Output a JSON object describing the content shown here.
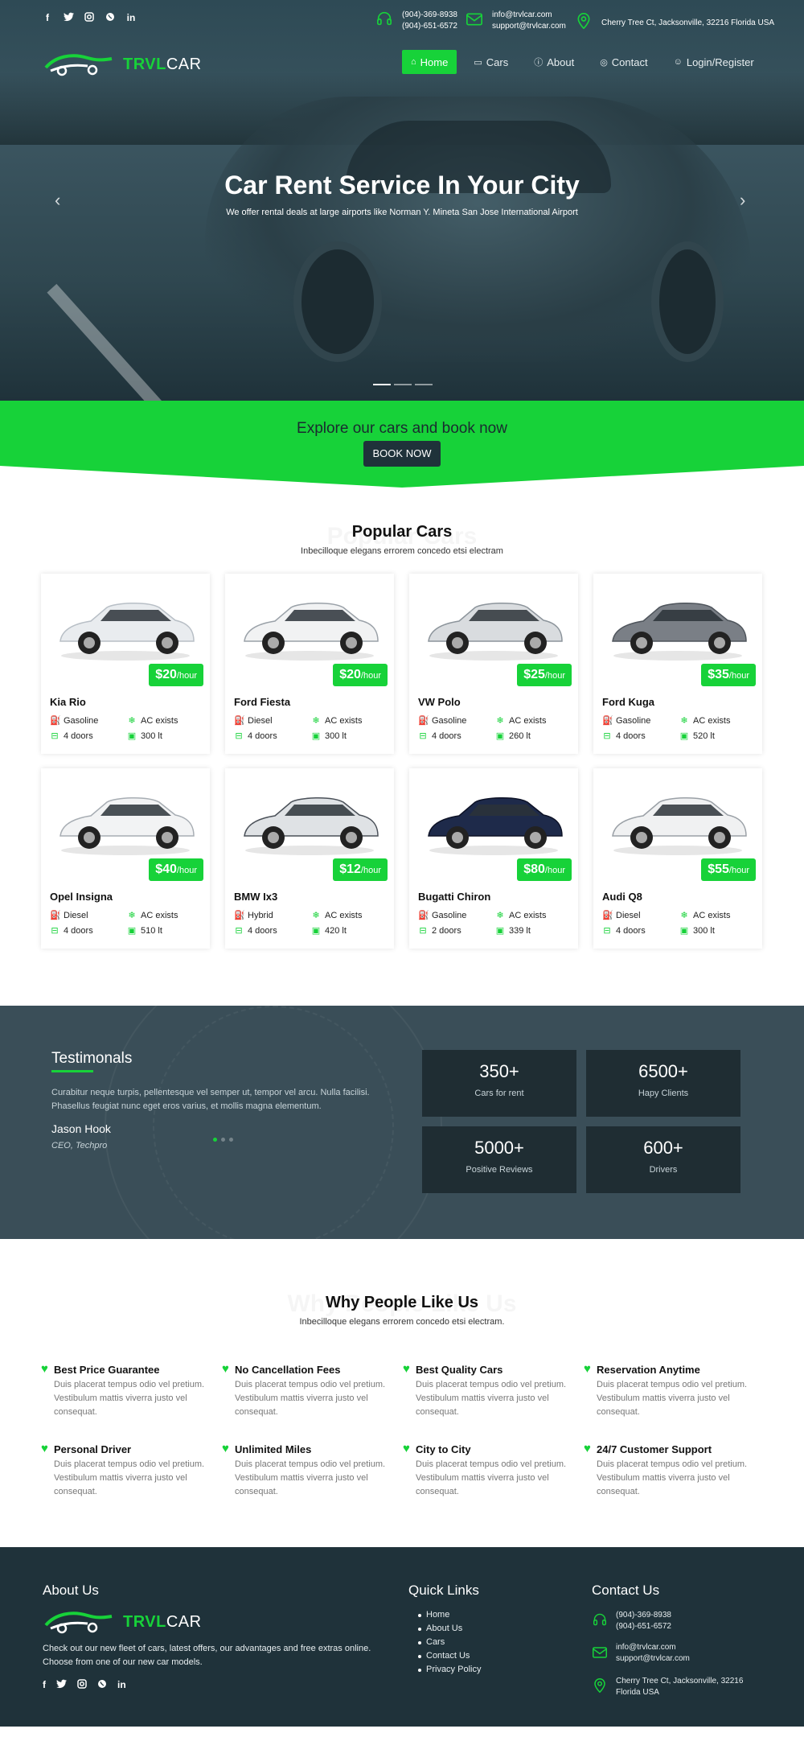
{
  "topbar": {
    "social": [
      "f",
      "t",
      "ig",
      "wa",
      "in"
    ],
    "phone": [
      "(904)-369-8938",
      "(904)-651-6572"
    ],
    "email": [
      "info@trvlcar.com",
      "support@trvlcar.com"
    ],
    "address": "Cherry Tree Ct, Jacksonville, 32216 Florida USA"
  },
  "logo": {
    "part1": "TRVL",
    "part2": "CAR"
  },
  "nav": [
    {
      "label": "Home",
      "icon": "home-icon"
    },
    {
      "label": "Cars",
      "icon": "car-icon"
    },
    {
      "label": "About",
      "icon": "info-icon"
    },
    {
      "label": "Contact",
      "icon": "location-icon"
    },
    {
      "label": "Login/Register",
      "icon": "user-icon"
    }
  ],
  "hero": {
    "title": "Car Rent Service In Your City",
    "subtitle": "We offer rental deals at large airports like Norman Y. Mineta San Jose International Airport"
  },
  "cta": {
    "title": "Explore our cars and book now",
    "button": "BOOK NOW"
  },
  "popular": {
    "ghost": "Popular Cars",
    "title": "Popular Cars",
    "subtitle": "Inbecilloque elegans errorem concedo etsi electram",
    "cars": [
      {
        "name": "Kia Rio",
        "price": "$20",
        "unit": "/hour",
        "fuel": "Gasoline",
        "ac": "AC exists",
        "doors": "4 doors",
        "trunk": "300 lt",
        "color": "#e9ecef",
        "accent": "#b8bfc6"
      },
      {
        "name": "Ford Fiesta",
        "price": "$20",
        "unit": "/hour",
        "fuel": "Diesel",
        "ac": "AC exists",
        "doors": "4 doors",
        "trunk": "300 lt",
        "color": "#f1f2f3",
        "accent": "#9aa1a8"
      },
      {
        "name": "VW Polo",
        "price": "$25",
        "unit": "/hour",
        "fuel": "Gasoline",
        "ac": "AC exists",
        "doors": "4 doors",
        "trunk": "260 lt",
        "color": "#d9dcdf",
        "accent": "#8c949b"
      },
      {
        "name": "Ford Kuga",
        "price": "$35",
        "unit": "/hour",
        "fuel": "Gasoline",
        "ac": "AC exists",
        "doors": "4 doors",
        "trunk": "520 lt",
        "color": "#7a7f86",
        "accent": "#4f555c"
      },
      {
        "name": "Opel Insigna",
        "price": "$40",
        "unit": "/hour",
        "fuel": "Diesel",
        "ac": "AC exists",
        "doors": "4 doors",
        "trunk": "510 lt",
        "color": "#f2f3f4",
        "accent": "#a7adb3"
      },
      {
        "name": "BMW Ix3",
        "price": "$12",
        "unit": "/hour",
        "fuel": "Hybrid",
        "ac": "AC exists",
        "doors": "4 doors",
        "trunk": "420 lt",
        "color": "#dfe2e5",
        "accent": "#4a5058"
      },
      {
        "name": "Bugatti Chiron",
        "price": "$80",
        "unit": "/hour",
        "fuel": "Gasoline",
        "ac": "AC exists",
        "doors": "2 doors",
        "trunk": "339 lt",
        "color": "#1e2a4a",
        "accent": "#0d1226"
      },
      {
        "name": "Audi Q8",
        "price": "$55",
        "unit": "/hour",
        "fuel": "Diesel",
        "ac": "AC exists",
        "doors": "4 doors",
        "trunk": "300 lt",
        "color": "#f0f1f2",
        "accent": "#9aa0a6"
      }
    ]
  },
  "testimonials": {
    "title": "Testimonals",
    "quote": "Curabitur neque turpis, pellentesque vel semper ut, tempor vel arcu. Nulla facilisi. Phasellus feugiat nunc eget eros varius, et mollis magna elementum.",
    "author": "Jason Hook",
    "role": "CEO, Techpro",
    "stats": [
      {
        "number": "350+",
        "label": "Cars for rent"
      },
      {
        "number": "6500+",
        "label": "Hapy Clients"
      },
      {
        "number": "5000+",
        "label": "Positive Reviews"
      },
      {
        "number": "600+",
        "label": "Drivers"
      }
    ]
  },
  "why": {
    "ghost": "Why People Like Us",
    "title": "Why People Like Us",
    "subtitle": "Inbecilloque elegans errorem concedo etsi electram.",
    "features": [
      {
        "title": "Best Price Guarantee",
        "desc": "Duis placerat tempus odio vel pretium. Vestibulum mattis viverra justo vel consequat."
      },
      {
        "title": "No Cancellation Fees",
        "desc": "Duis placerat tempus odio vel pretium. Vestibulum mattis viverra justo vel consequat."
      },
      {
        "title": "Best Quality Cars",
        "desc": "Duis placerat tempus odio vel pretium. Vestibulum mattis viverra justo vel consequat."
      },
      {
        "title": "Reservation Anytime",
        "desc": "Duis placerat tempus odio vel pretium. Vestibulum mattis viverra justo vel consequat."
      },
      {
        "title": "Personal Driver",
        "desc": "Duis placerat tempus odio vel pretium. Vestibulum mattis viverra justo vel consequat."
      },
      {
        "title": "Unlimited Miles",
        "desc": "Duis placerat tempus odio vel pretium. Vestibulum mattis viverra justo vel consequat."
      },
      {
        "title": "City to City",
        "desc": "Duis placerat tempus odio vel pretium. Vestibulum mattis viverra justo vel consequat."
      },
      {
        "title": "24/7 Customer Support",
        "desc": "Duis placerat tempus odio vel pretium. Vestibulum mattis viverra justo vel consequat."
      }
    ]
  },
  "footer": {
    "about_title": "About Us",
    "about_text": "Check out our new fleet of cars, latest offers, our advantages and free extras online. Choose from one of our new car models.",
    "links_title": "Quick Links",
    "links": [
      "Home",
      "About Us",
      "Cars",
      "Contact Us",
      "Privacy Policy"
    ],
    "contact_title": "Contact Us",
    "phone": [
      "(904)-369-8938",
      "(904)-651-6572"
    ],
    "email": [
      "info@trvlcar.com",
      "support@trvlcar.com"
    ],
    "address": [
      "Cherry Tree Ct, Jacksonville, 32216",
      "Florida USA"
    ]
  },
  "colors": {
    "accent": "#17d239",
    "dark": "#1f323a",
    "slate": "#3a4e58"
  }
}
